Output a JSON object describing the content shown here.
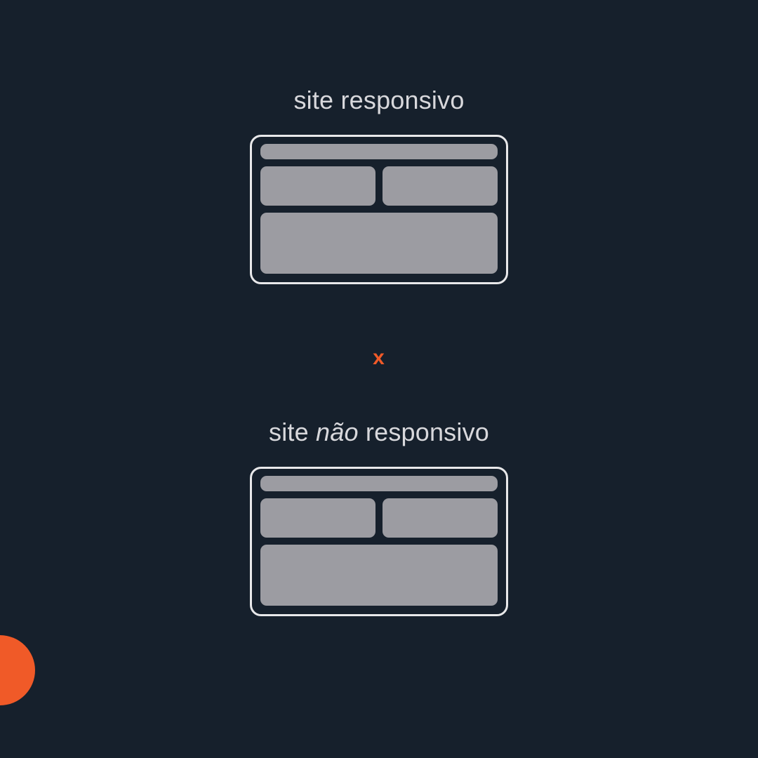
{
  "section1": {
    "title": "site responsivo"
  },
  "separator": "x",
  "section2": {
    "title_pre": "site ",
    "title_em": "não",
    "title_post": " responsivo"
  },
  "colors": {
    "background": "#16202c",
    "text": "#d8d8dc",
    "accent": "#f05a28",
    "block": "#9c9ca2",
    "border": "#e8e8ea"
  }
}
